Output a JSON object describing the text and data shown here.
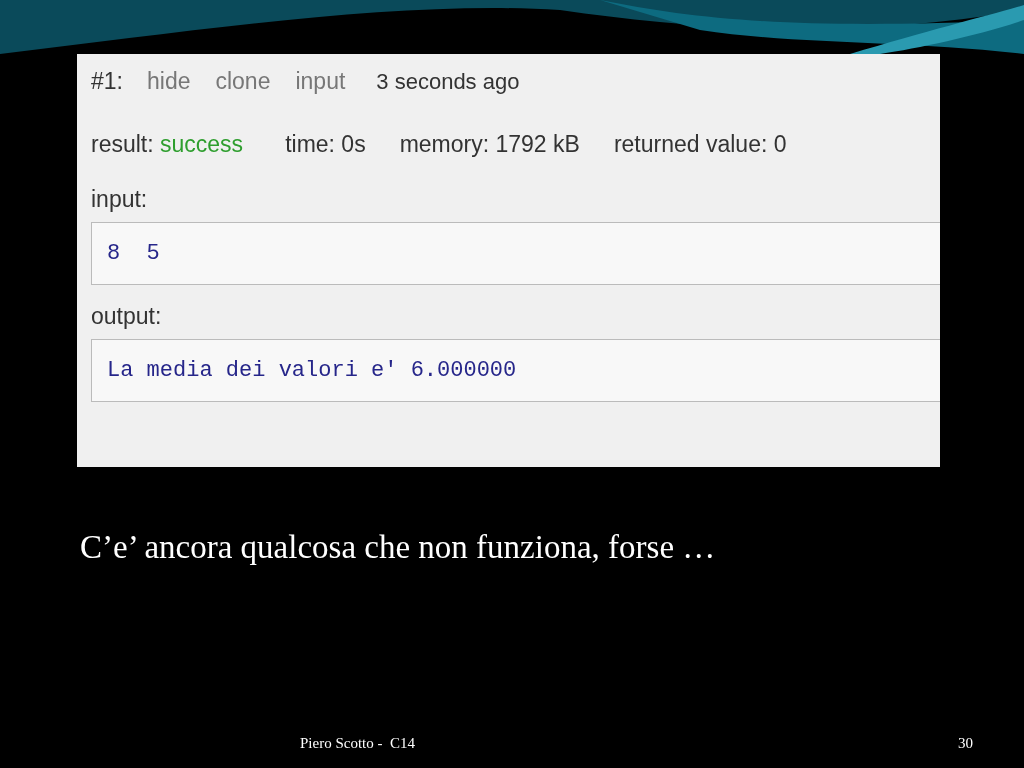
{
  "submission": {
    "number": "#1:",
    "links": [
      "hide",
      "clone",
      "input"
    ],
    "time_ago": "3 seconds ago"
  },
  "result": {
    "label": "result:",
    "value": "success"
  },
  "stats": [
    "time: 0s",
    "memory: 1792 kB",
    "returned value: 0"
  ],
  "sections": [
    {
      "label": "input:",
      "value": "8  5"
    },
    {
      "label": "output:",
      "value": "La media dei valori e' 6.000000"
    }
  ],
  "caption": "C’e’ ancora qualcosa che non funziona, forse …",
  "footer": {
    "author": "Piero Scotto -  C14",
    "page": "30"
  }
}
